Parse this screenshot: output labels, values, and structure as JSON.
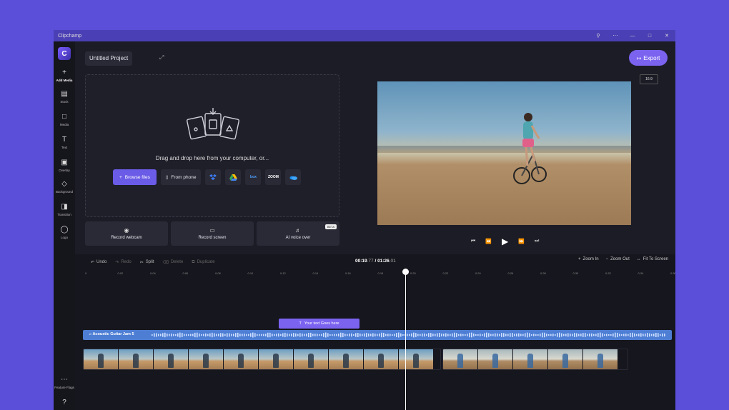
{
  "app": {
    "title": "Clipchamp"
  },
  "colors": {
    "background": "#5b4fd9",
    "accent": "#7b63f0",
    "audio_track": "#4d7ed4"
  },
  "window_controls": [
    "search-icon",
    "minimize-icon",
    "maximize-icon",
    "close-icon"
  ],
  "sidebar": {
    "items": [
      {
        "label": "Add Media",
        "icon": "plus-icon"
      },
      {
        "label": "Stock",
        "icon": "stock-icon"
      },
      {
        "label": "Media",
        "icon": "media-icon"
      },
      {
        "label": "Text",
        "icon": "text-icon"
      },
      {
        "label": "Overlay",
        "icon": "overlay-icon"
      },
      {
        "label": "Background",
        "icon": "layers-icon"
      },
      {
        "label": "Transition",
        "icon": "transition-icon"
      },
      {
        "label": "Logo",
        "icon": "shield-icon"
      }
    ],
    "bottom": {
      "label": "Feature Flags",
      "icon": "more-icon"
    }
  },
  "project": {
    "name": "Untitled Project"
  },
  "export": {
    "label": "Export"
  },
  "preview": {
    "ratio": "16:9"
  },
  "import": {
    "prompt": "Drag and drop here from your computer, or...",
    "browse_label": "Browse files",
    "phone_label": "From phone",
    "services": [
      "dropbox-icon",
      "google-drive-icon",
      "box-icon",
      "zoom-icon",
      "onedrive-icon"
    ],
    "services_text": {
      "box": "box",
      "zoom": "ZOOM"
    }
  },
  "record": [
    {
      "label": "Record webcam",
      "icon": "webcam-icon"
    },
    {
      "label": "Record screen",
      "icon": "screen-icon"
    },
    {
      "label": "AI voice over",
      "icon": "voice-icon",
      "badge": "BETA"
    }
  ],
  "timeline": {
    "tools": [
      {
        "label": "Undo",
        "enabled": true
      },
      {
        "label": "Redo",
        "enabled": false
      },
      {
        "label": "Split",
        "enabled": true
      },
      {
        "label": "Delete",
        "enabled": false
      },
      {
        "label": "Duplicate",
        "enabled": false
      }
    ],
    "time_current": "00:19",
    "time_current_frac": ".77",
    "time_separator": " / ",
    "time_total": "01:26",
    "time_total_frac": ".01",
    "zoom_in": "Zoom In",
    "zoom_out": "Zoom Out",
    "fit": "Fit To Screen",
    "ruler": [
      "0",
      "0:02",
      "0:04",
      "0:06",
      "0:08",
      "0:10",
      "0:12",
      "0:14",
      "0:16",
      "0:18",
      "0:20",
      "0:22",
      "0:24",
      "0:26",
      "0:28",
      "0:30",
      "0:32",
      "0:34",
      "0:36"
    ],
    "text_clip": "Your text Goes here",
    "audio_clip": "Acoustic Guitar Jam 5"
  }
}
